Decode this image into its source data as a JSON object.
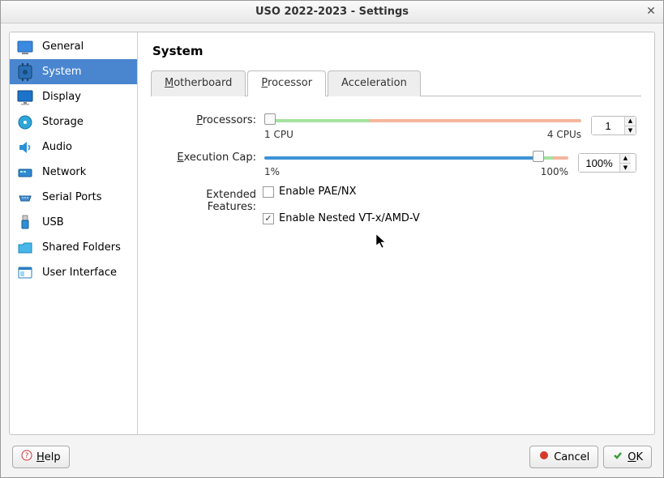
{
  "title": "USO 2022-2023 - Settings",
  "sidebar": {
    "items": [
      {
        "label": "General"
      },
      {
        "label": "System"
      },
      {
        "label": "Display"
      },
      {
        "label": "Storage"
      },
      {
        "label": "Audio"
      },
      {
        "label": "Network"
      },
      {
        "label": "Serial Ports"
      },
      {
        "label": "USB"
      },
      {
        "label": "Shared Folders"
      },
      {
        "label": "User Interface"
      }
    ],
    "selected_index": 1
  },
  "content": {
    "heading": "System",
    "tabs": [
      {
        "pre": "",
        "ul": "M",
        "post": "otherboard"
      },
      {
        "pre": "",
        "ul": "P",
        "post": "rocessor"
      },
      {
        "pre": "Acceleration",
        "ul": "",
        "post": ""
      }
    ],
    "active_tab": 1,
    "processors": {
      "label_pre": "",
      "label_ul": "P",
      "label_post": "rocessors:",
      "value": "1",
      "min_label": "1 CPU",
      "max_label": "4 CPUs",
      "slider_green_pct": 33,
      "slider_red_pct": 67,
      "thumb_pct": 0
    },
    "exec_cap": {
      "label_pre": "",
      "label_ul": "E",
      "label_post": "xecution Cap:",
      "value": "100%",
      "min_label": "1%",
      "max_label": "100%",
      "slider_blue_pct": 90,
      "slider_green_pct": 5,
      "slider_red_pct": 5,
      "thumb_pct": 90
    },
    "extended": {
      "label": "Extended Features:",
      "pae": {
        "text_pre": "Enable PA",
        "text_ul": "E",
        "text_post": "/NX",
        "checked": false
      },
      "nested": {
        "text_pre": "Enable Nested ",
        "text_ul": "V",
        "text_post": "T-x/AMD-V",
        "checked": true
      }
    }
  },
  "footer": {
    "help_pre": "",
    "help_ul": "H",
    "help_post": "elp",
    "cancel": "Cancel",
    "ok_pre": "",
    "ok_ul": "O",
    "ok_post": "K"
  }
}
